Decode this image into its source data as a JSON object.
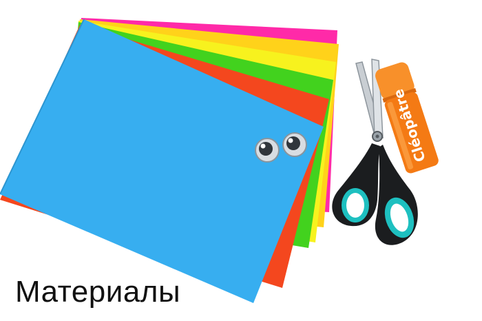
{
  "caption": "Материалы",
  "glue_stick": {
    "brand": "Cléopâtre"
  },
  "paper_colors": {
    "magenta": "#ff2aa8",
    "yellow": "#ffd21a",
    "lemon": "#f7f21e",
    "green": "#42d21e",
    "red": "#f4471e",
    "blue": "#37aef0"
  },
  "scissors_handle_color": "#1ec0c0",
  "glue_stick_color": "#f47a14"
}
